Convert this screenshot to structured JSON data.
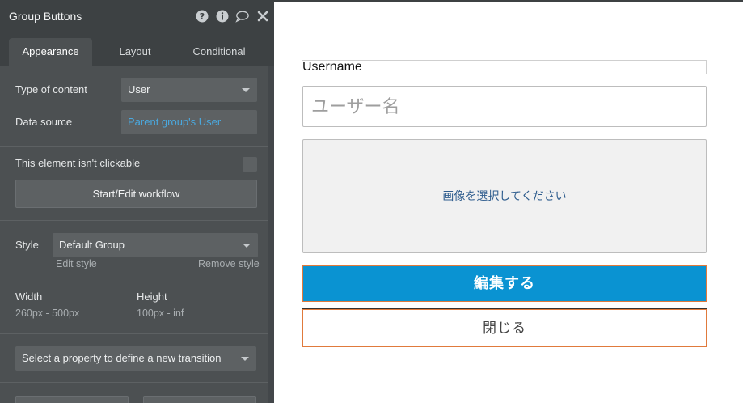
{
  "panel": {
    "title": "Group Buttons",
    "header_icons": [
      "help-icon",
      "info-icon",
      "comment-icon",
      "close-icon"
    ],
    "tabs": [
      {
        "label": "Appearance",
        "active": true
      },
      {
        "label": "Layout",
        "active": false
      },
      {
        "label": "Conditional",
        "active": false
      }
    ],
    "type_of_content": {
      "label": "Type of content",
      "value": "User"
    },
    "data_source": {
      "label": "Data source",
      "value": "Parent group's User"
    },
    "clickable": {
      "label": "This element isn't clickable",
      "checked": false
    },
    "workflow_button": "Start/Edit workflow",
    "style": {
      "label": "Style",
      "value": "Default Group",
      "edit_link": "Edit style",
      "remove_link": "Remove style"
    },
    "width": {
      "label": "Width",
      "value": "260px - 500px"
    },
    "height": {
      "label": "Height",
      "value": "100px - inf"
    },
    "transition": {
      "placeholder": "Select a property to define a new transition"
    }
  },
  "canvas": {
    "username_label": "Username",
    "username_placeholder": "ユーザー名",
    "image_picker_text": "画像を選択してください",
    "edit_button": "編集する",
    "close_button": "閉じる"
  },
  "colors": {
    "panel_bg": "#4c5052",
    "panel_header": "#3d4143",
    "accent_link": "#4aa8de",
    "primary_button": "#0a93d2",
    "button_border": "#e07a3c"
  }
}
